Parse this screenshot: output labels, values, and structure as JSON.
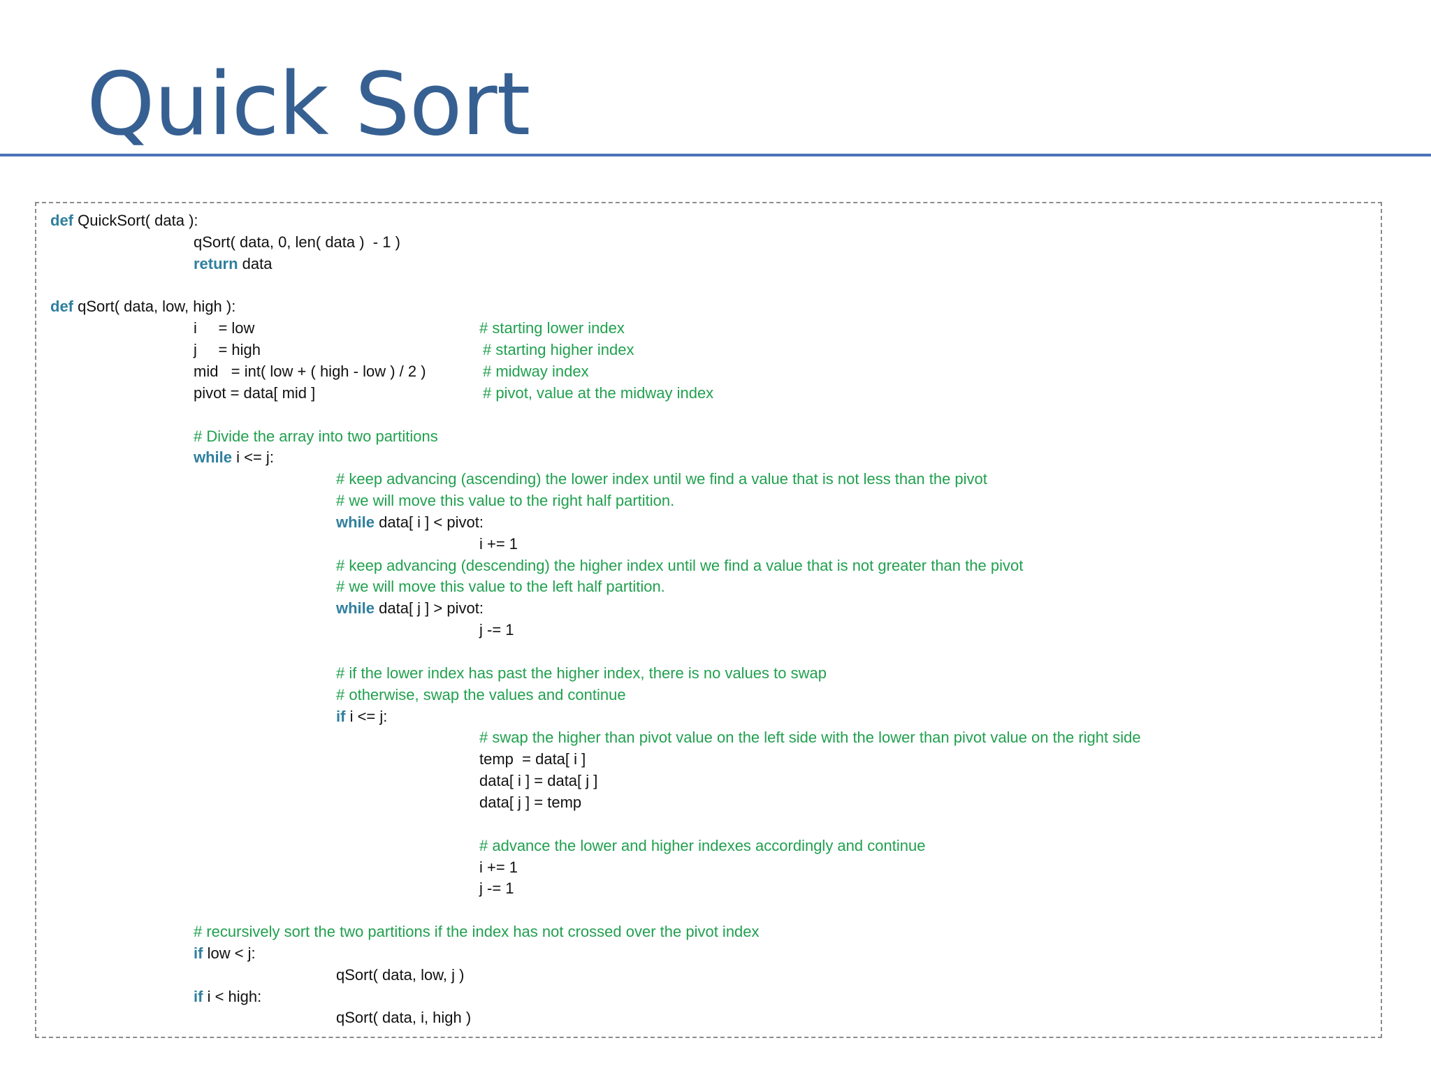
{
  "title": "Quick Sort",
  "colors": {
    "title": "#376092",
    "rule": "#4a72b8",
    "keyword": "#2f7f9e",
    "comment": "#21a04f",
    "text": "#111111",
    "box_border": "#8c8c8c"
  },
  "code": [
    {
      "indent": 0,
      "tokens": [
        {
          "t": "kw",
          "v": "def"
        },
        {
          "t": "tx",
          "v": " QuickSort( data ):"
        }
      ]
    },
    {
      "indent": 1,
      "tokens": [
        {
          "t": "tx",
          "v": "qSort( data, 0, len( data )  - 1 )"
        }
      ]
    },
    {
      "indent": 1,
      "tokens": [
        {
          "t": "kw",
          "v": "return"
        },
        {
          "t": "tx",
          "v": " data"
        }
      ]
    },
    {
      "indent": 0,
      "tokens": []
    },
    {
      "indent": 0,
      "tokens": [
        {
          "t": "kw",
          "v": "def"
        },
        {
          "t": "tx",
          "v": " qSort( data, low, high ):"
        }
      ]
    },
    {
      "indent": 1,
      "tokens": [
        {
          "t": "tx",
          "v": "i     = low"
        }
      ],
      "comment": {
        "col": 0,
        "v": "# starting lower index"
      }
    },
    {
      "indent": 1,
      "tokens": [
        {
          "t": "tx",
          "v": "j     = high"
        }
      ],
      "comment": {
        "col": 1,
        "v": "# starting higher index"
      }
    },
    {
      "indent": 1,
      "tokens": [
        {
          "t": "tx",
          "v": "mid   = int( low + ( high - low ) / 2 )"
        }
      ],
      "comment": {
        "col": 1,
        "v": "# midway index"
      }
    },
    {
      "indent": 1,
      "tokens": [
        {
          "t": "tx",
          "v": "pivot = data[ mid ]"
        }
      ],
      "comment": {
        "col": 1,
        "v": "# pivot, value at the midway index"
      }
    },
    {
      "indent": 0,
      "tokens": []
    },
    {
      "indent": 1,
      "tokens": [
        {
          "t": "cm",
          "v": "# Divide the array into two partitions"
        }
      ]
    },
    {
      "indent": 1,
      "tokens": [
        {
          "t": "kw",
          "v": "while"
        },
        {
          "t": "tx",
          "v": " i <= j:"
        }
      ]
    },
    {
      "indent": 2,
      "tokens": [
        {
          "t": "cm",
          "v": "# keep advancing (ascending) the lower index until we find a value that is not less than the pivot"
        }
      ]
    },
    {
      "indent": 2,
      "tokens": [
        {
          "t": "cm",
          "v": "# we will move this value to the right half partition."
        }
      ]
    },
    {
      "indent": 2,
      "tokens": [
        {
          "t": "kw",
          "v": "while"
        },
        {
          "t": "tx",
          "v": " data[ i ] < pivot:"
        }
      ]
    },
    {
      "indent": 3,
      "tokens": [
        {
          "t": "tx",
          "v": "i += 1"
        }
      ]
    },
    {
      "indent": 2,
      "tokens": [
        {
          "t": "cm",
          "v": "# keep advancing (descending) the higher index until we find a value that is not greater than the pivot"
        }
      ]
    },
    {
      "indent": 2,
      "tokens": [
        {
          "t": "cm",
          "v": "# we will move this value to the left half partition."
        }
      ]
    },
    {
      "indent": 2,
      "tokens": [
        {
          "t": "kw",
          "v": "while"
        },
        {
          "t": "tx",
          "v": " data[ j ] > pivot:"
        }
      ]
    },
    {
      "indent": 3,
      "tokens": [
        {
          "t": "tx",
          "v": "j -= 1"
        }
      ]
    },
    {
      "indent": 0,
      "tokens": []
    },
    {
      "indent": 2,
      "tokens": [
        {
          "t": "cm",
          "v": "# if the lower index has past the higher index, there is no values to swap"
        }
      ]
    },
    {
      "indent": 2,
      "tokens": [
        {
          "t": "cm",
          "v": "# otherwise, swap the values and continue"
        }
      ]
    },
    {
      "indent": 2,
      "tokens": [
        {
          "t": "kw",
          "v": "if"
        },
        {
          "t": "tx",
          "v": " i <= j:"
        }
      ]
    },
    {
      "indent": 3,
      "tokens": [
        {
          "t": "cm",
          "v": "# swap the higher than pivot value on the left side with the lower than pivot value on the right side"
        }
      ]
    },
    {
      "indent": 3,
      "tokens": [
        {
          "t": "tx",
          "v": "temp  = data[ i ]"
        }
      ]
    },
    {
      "indent": 3,
      "tokens": [
        {
          "t": "tx",
          "v": "data[ i ] = data[ j ]"
        }
      ]
    },
    {
      "indent": 3,
      "tokens": [
        {
          "t": "tx",
          "v": "data[ j ] = temp"
        }
      ]
    },
    {
      "indent": 0,
      "tokens": []
    },
    {
      "indent": 3,
      "tokens": [
        {
          "t": "cm",
          "v": "# advance the lower and higher indexes accordingly and continue"
        }
      ]
    },
    {
      "indent": 3,
      "tokens": [
        {
          "t": "tx",
          "v": "i += 1"
        }
      ]
    },
    {
      "indent": 3,
      "tokens": [
        {
          "t": "tx",
          "v": "j -= 1"
        }
      ]
    },
    {
      "indent": 0,
      "tokens": []
    },
    {
      "indent": 1,
      "tokens": [
        {
          "t": "cm",
          "v": "# recursively sort the two partitions if the index has not crossed over the pivot index"
        }
      ]
    },
    {
      "indent": 1,
      "tokens": [
        {
          "t": "kw",
          "v": "if"
        },
        {
          "t": "tx",
          "v": " low < j:"
        }
      ]
    },
    {
      "indent": 2,
      "tokens": [
        {
          "t": "tx",
          "v": "qSort( data, low, j )"
        }
      ]
    },
    {
      "indent": 1,
      "tokens": [
        {
          "t": "kw",
          "v": "if"
        },
        {
          "t": "tx",
          "v": " i < high:"
        }
      ]
    },
    {
      "indent": 2,
      "tokens": [
        {
          "t": "tx",
          "v": "qSort( data, i, high )"
        }
      ]
    }
  ]
}
